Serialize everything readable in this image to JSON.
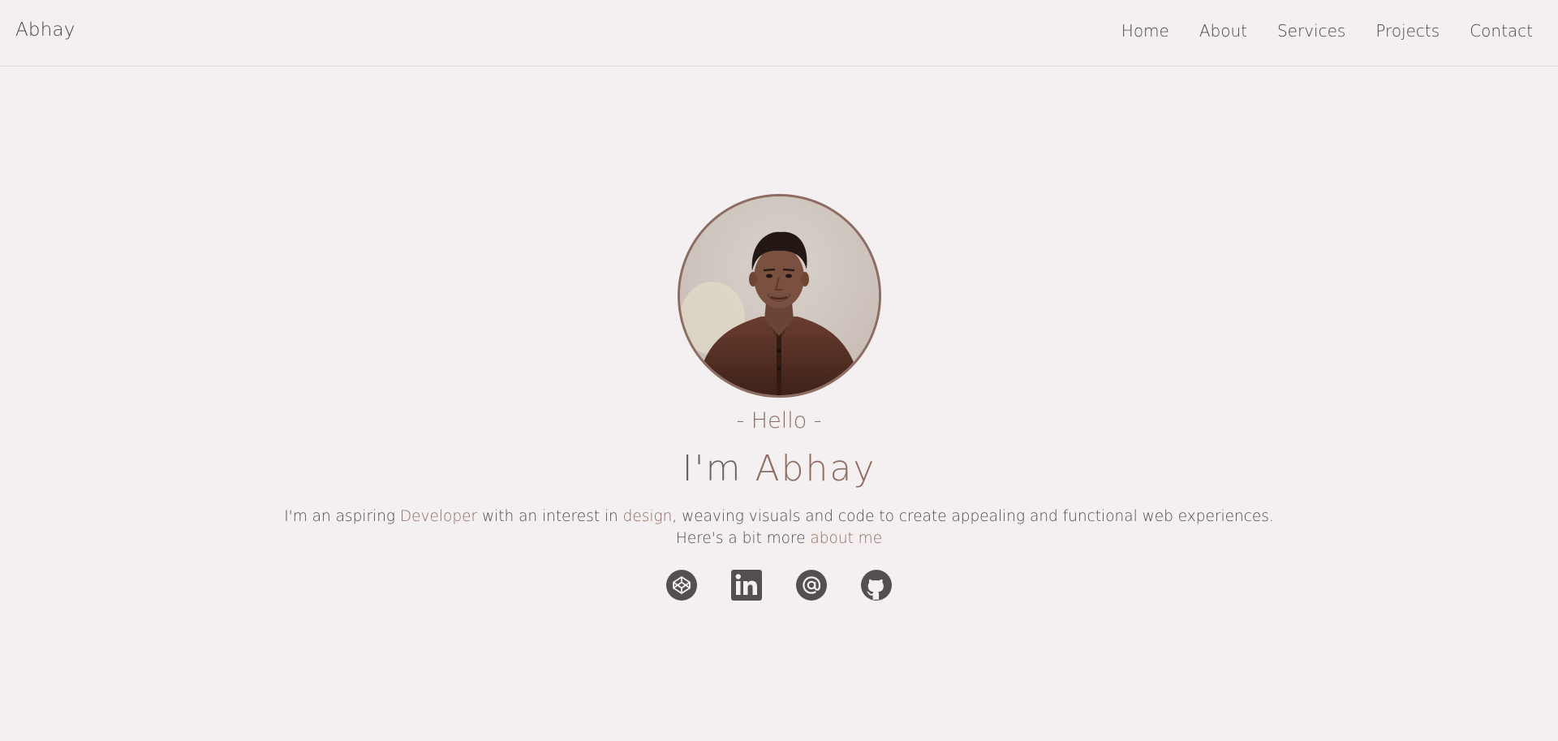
{
  "brand": "Abhay",
  "nav": {
    "items": [
      {
        "label": "Home"
      },
      {
        "label": "About"
      },
      {
        "label": "Services"
      },
      {
        "label": "Projects"
      },
      {
        "label": "Contact"
      }
    ]
  },
  "hero": {
    "greeting": "- Hello -",
    "headline_prefix": "I'm ",
    "headline_name": "Abhay",
    "bio": {
      "part1": "I'm an aspiring ",
      "role": "Developer",
      "part2": " with an interest in ",
      "interest": "design",
      "part3": ", weaving visuals and code to create appealing and functional web experiences.",
      "line2_prefix": "Here's a bit more ",
      "about_link": "about me"
    }
  },
  "socials": [
    {
      "icon": "codepen-icon"
    },
    {
      "icon": "linkedin-icon"
    },
    {
      "icon": "email-at-icon"
    },
    {
      "icon": "github-icon"
    }
  ],
  "colors": {
    "background": "#f4eff0",
    "accent": "#8d6c62",
    "text": "#4e4a48",
    "icon": "#555050"
  }
}
